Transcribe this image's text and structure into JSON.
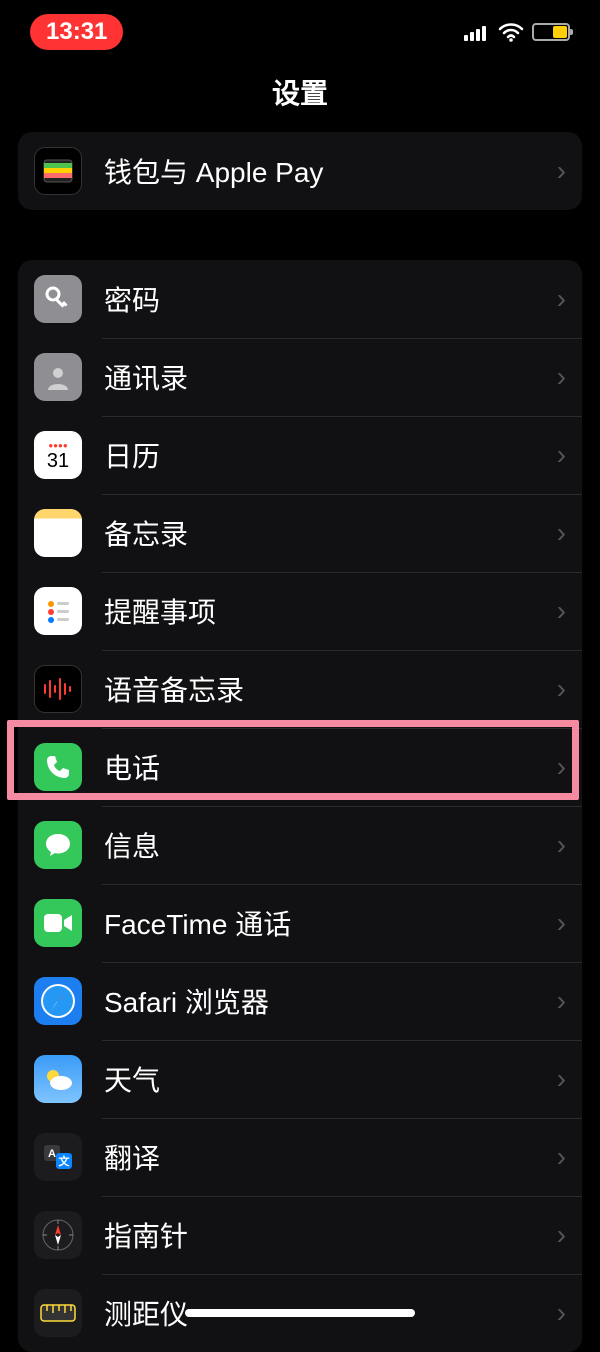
{
  "status": {
    "time": "13:31"
  },
  "title": "设置",
  "groups": [
    {
      "items": [
        {
          "key": "wallet",
          "label": "钱包与 Apple Pay"
        }
      ]
    },
    {
      "items": [
        {
          "key": "password",
          "label": "密码"
        },
        {
          "key": "contacts",
          "label": "通讯录"
        },
        {
          "key": "calendar",
          "label": "日历"
        },
        {
          "key": "notes",
          "label": "备忘录"
        },
        {
          "key": "reminders",
          "label": "提醒事项"
        },
        {
          "key": "voicememo",
          "label": "语音备忘录"
        },
        {
          "key": "phone",
          "label": "电话"
        },
        {
          "key": "messages",
          "label": "信息"
        },
        {
          "key": "facetime",
          "label": "FaceTime 通话"
        },
        {
          "key": "safari",
          "label": "Safari 浏览器"
        },
        {
          "key": "weather",
          "label": "天气"
        },
        {
          "key": "translate",
          "label": "翻译"
        },
        {
          "key": "compass",
          "label": "指南针"
        },
        {
          "key": "measure",
          "label": "测距仪"
        }
      ]
    }
  ],
  "highlighted_key": "phone"
}
